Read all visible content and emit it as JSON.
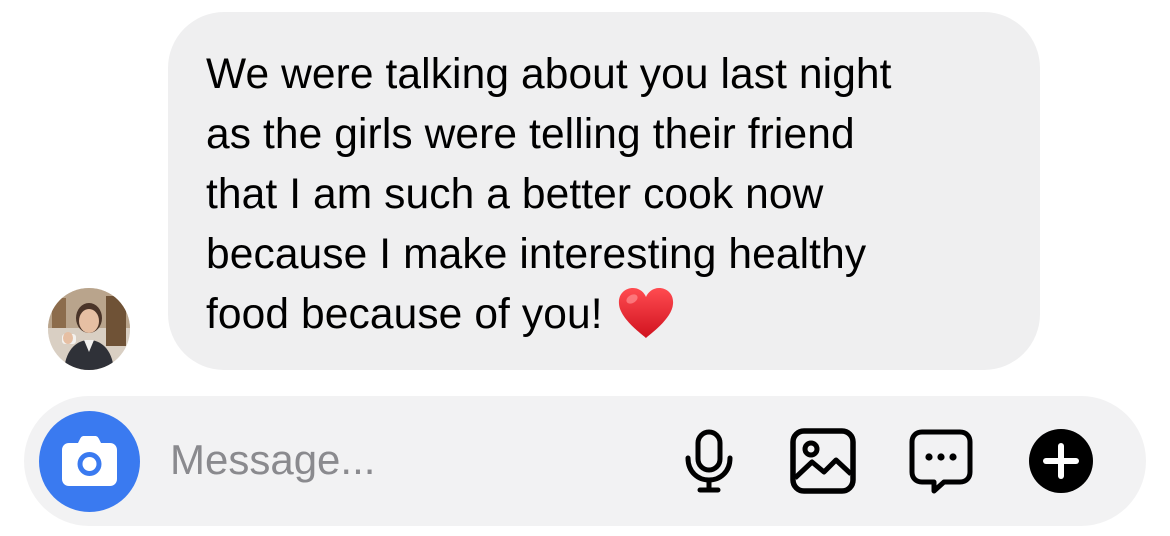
{
  "thread": {
    "incoming_message": {
      "lines": [
        "We were talking about you last night",
        "as the girls were telling their friend",
        "that I am such a better cook now",
        "because I make interesting healthy",
        "food because of you!"
      ],
      "emoji": "red-heart"
    },
    "sender_avatar": "profile-photo"
  },
  "composer": {
    "placeholder": "Message...",
    "value": "",
    "icons": [
      "camera-icon",
      "microphone-icon",
      "gallery-icon",
      "sticker-chat-icon",
      "plus-icon"
    ],
    "camera_color": "#3a7af0"
  },
  "colors": {
    "bubble": "#efeff0",
    "composer": "#f2f2f3",
    "heart": "#e8202c"
  }
}
